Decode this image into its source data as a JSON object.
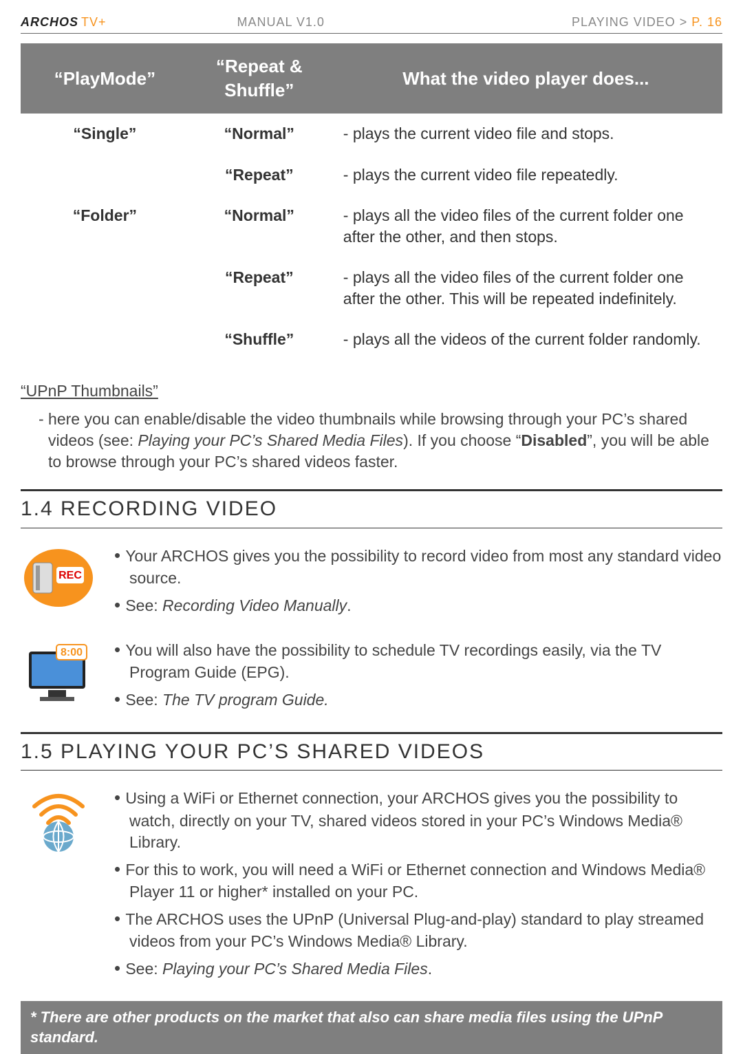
{
  "header": {
    "brand": "ARCHOS",
    "tvplus": "TV+",
    "manual": "MANUAL V1.0",
    "crumb": "PLAYING VIDEO",
    "sep": ">",
    "page": "P. 16"
  },
  "table": {
    "headers": {
      "c1": "“PlayMode”",
      "c2": "“Repeat & Shuffle”",
      "c3": "What the video player does..."
    },
    "rows": [
      {
        "c1": "“Single”",
        "c2": "“Normal”",
        "desc": "- plays the current video file and stops."
      },
      {
        "c1": "",
        "c2": "“Repeat”",
        "desc": "- plays the current video file repeatedly."
      },
      {
        "c1": "“Folder”",
        "c2": "“Normal”",
        "desc": "- plays all the video files of the current folder one after the other, and then stops."
      },
      {
        "c1": "",
        "c2": "“Repeat”",
        "desc": "- plays all the video files of the current folder one after the other. This will be repeated indefinitely."
      },
      {
        "c1": "",
        "c2": "“Shuffle”",
        "desc": "- plays all the videos of the current folder randomly."
      }
    ]
  },
  "upnp": {
    "title": "“UPnP Thumbnails”",
    "para_pre": "- here you can enable/disable the video thumbnails while browsing through your PC’s shared videos (see: ",
    "para_ital": "Playing your PC’s Shared Media Files",
    "para_mid": "). If you choose “",
    "para_bold": "Disabled",
    "para_end": "”, you will be able to browse through your PC’s shared videos faster."
  },
  "sec14": {
    "title": "1.4  Recording Video",
    "b1": "Your ARCHOS gives you the possibility to record video from most any standard video source.",
    "b2a": "See: ",
    "b2b": "Recording Video Manually",
    "b2c": ".",
    "b3": "You will also have the possibility to schedule TV recordings easily, via the TV Program Guide (EPG).",
    "b4a": "See: ",
    "b4b": "The TV program Guide.",
    "epg_time": "8:00"
  },
  "sec15": {
    "title": "1.5  Playing your PC’s shared Videos",
    "b1": "Using a WiFi or Ethernet connection, your ARCHOS gives you the possibility to watch, directly on your TV, shared videos stored in your PC’s Windows Media® Library.",
    "b2": "For this to work, you will need a WiFi or Ethernet connection and Windows Media® Player 11 or higher* installed on your PC.",
    "b3": "The ARCHOS uses the UPnP (Universal Plug-and-play) standard to play streamed videos from your PC’s Windows Media® Library.",
    "b4a": "See: ",
    "b4b": "Playing your PC’s Shared Media Files",
    "b4c": "."
  },
  "footnote": "* There are other products on the market that also can share media files using the UPnP standard."
}
